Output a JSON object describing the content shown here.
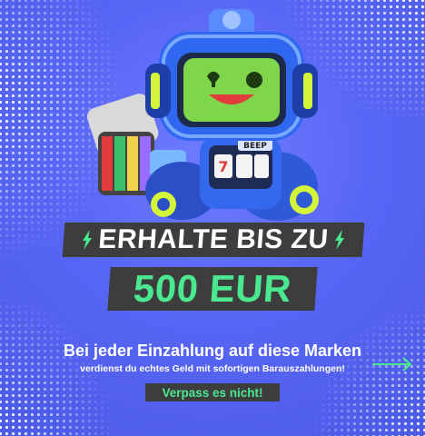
{
  "banner": {
    "headline": "ERHALTE BIS ZU",
    "amount": "500 EUR",
    "line1": "Bei jeder Einzahlung auf diese Marken",
    "line2": "verdienst du echtes Geld mit sofortigen Barauszahlungen!",
    "cta": "Verpass es nicht!",
    "robot_badge": "BEEP",
    "reel_digit": "7"
  },
  "colors": {
    "background": "#5866f5",
    "accent_green": "#4ae88f",
    "label_bg": "#3d3d3d",
    "text": "#ffffff"
  },
  "icons": [
    "lightning-bolt-icon",
    "right-arrow-icon",
    "robot-mascot"
  ]
}
